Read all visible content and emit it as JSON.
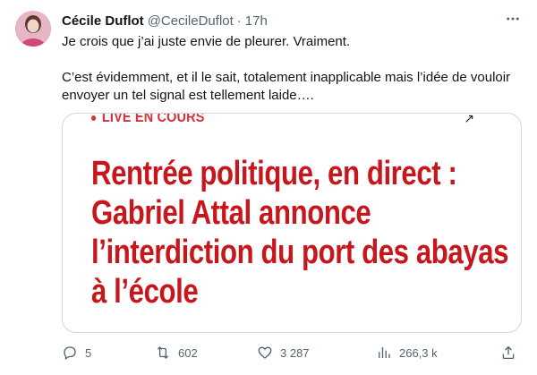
{
  "author": {
    "name": "Cécile Duflot",
    "handle": "@CecileDuflot",
    "dot": "·",
    "time": "17h"
  },
  "tweet": {
    "paragraph1": "Je crois que j’ai juste envie de pleurer. Vraiment.",
    "paragraph2": "C’est évidemment, et il le sait, totalement inapplicable mais l’idée de vouloir envoyer un tel signal est tellement laide…."
  },
  "media": {
    "live_label": "LIVE EN COURS",
    "headline_lines": [
      "Rentrée politique, en direct :",
      "Gabriel Attal annonce",
      "l’interdiction du port des abayas",
      "à l’école"
    ],
    "accent_color": "#c8161d"
  },
  "actions": {
    "replies": "5",
    "retweets": "602",
    "likes": "3 287",
    "views": "266,3 k"
  },
  "icons": {
    "reply": "reply-icon",
    "retweet": "retweet-icon",
    "like": "heart-icon",
    "views": "views-icon",
    "share": "share-icon",
    "more": "more-icon"
  }
}
